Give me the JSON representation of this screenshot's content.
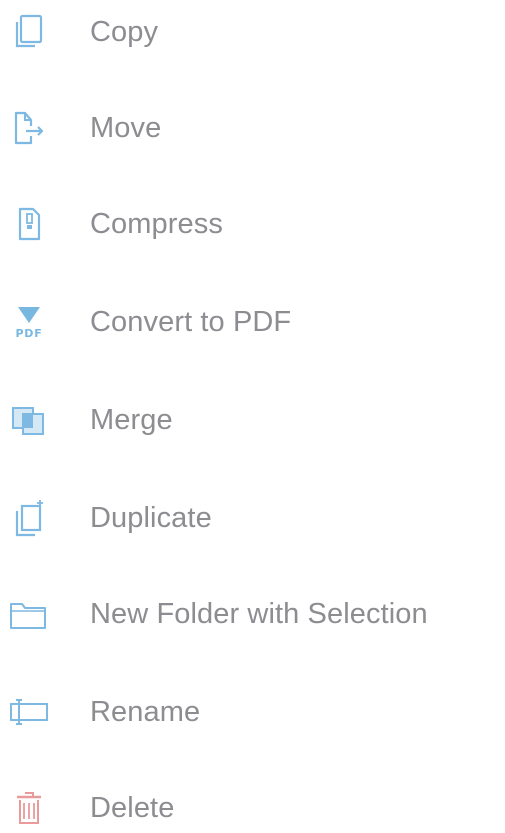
{
  "menu": {
    "accent_color": "#7db9e2",
    "delete_color": "#e99a9a",
    "items": [
      {
        "label": "Copy",
        "icon": "copy-icon"
      },
      {
        "label": "Move",
        "icon": "move-icon"
      },
      {
        "label": "Compress",
        "icon": "compress-icon"
      },
      {
        "label": "Convert to PDF",
        "icon": "convert-to-pdf-icon",
        "icon_text": "PDF"
      },
      {
        "label": "Merge",
        "icon": "merge-icon"
      },
      {
        "label": "Duplicate",
        "icon": "duplicate-icon"
      },
      {
        "label": "New Folder with Selection",
        "icon": "new-folder-icon"
      },
      {
        "label": "Rename",
        "icon": "rename-icon"
      },
      {
        "label": "Delete",
        "icon": "trash-icon"
      }
    ]
  }
}
